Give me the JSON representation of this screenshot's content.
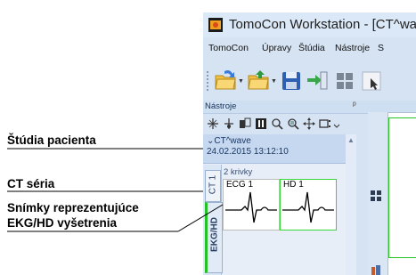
{
  "annotations": [
    {
      "text": "Štúdia pacienta"
    },
    {
      "text": "CT séria"
    },
    {
      "text": "Snímky reprezentujúce"
    },
    {
      "text": "EKG/HD vyšetrenia"
    }
  ],
  "window": {
    "title": "TomoCon Workstation - [CT^wa"
  },
  "menu": [
    "TomoCon",
    "Úpravy",
    "Štúdia",
    "Nástroje",
    "S"
  ],
  "toolbar": {
    "icons": [
      "open-folder-icon",
      "open-folder-up-icon",
      "save-icon",
      "export-icon",
      "grid-layout-icon"
    ]
  },
  "panel": {
    "title": "Nástroje",
    "pin_glyph": "ᵖ"
  },
  "tools": [
    "crosshair-icon",
    "move-points-icon",
    "window-level-icon",
    "invert-icon",
    "zoom-icon",
    "zoom-region-icon",
    "pan-icon",
    "roi-icon"
  ],
  "study": {
    "name": "CT^wave",
    "datetime": "24.02.2015 13:12:10"
  },
  "series": {
    "ct_tab": "CT 1",
    "ekg_tab": "EKG/HD",
    "count_label": "2 krivky",
    "thumbnails": [
      {
        "label": "ECG 1",
        "selected": false
      },
      {
        "label": "HD 1",
        "selected": true
      }
    ]
  },
  "colors": {
    "selection_green": "#37d837",
    "panel_bg": "#d6e3f3"
  }
}
